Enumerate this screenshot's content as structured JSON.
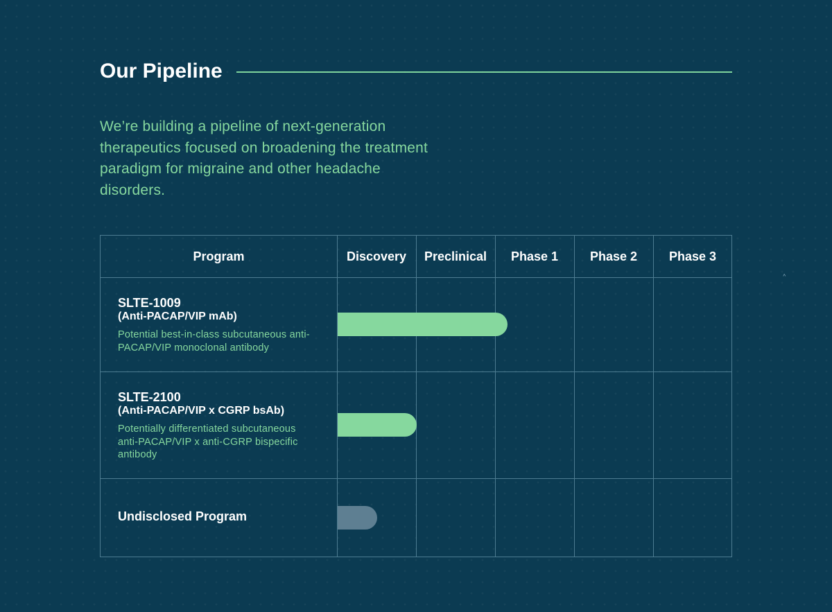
{
  "title": "Our Pipeline",
  "intro": "We’re building a pipeline of next-generation therapeutics focused on broadening the treatment paradigm for migraine and other headache disorders.",
  "table": {
    "headers": [
      "Program",
      "Discovery",
      "Preclinical",
      "Phase 1",
      "Phase 2",
      "Phase 3"
    ],
    "rows": [
      {
        "name": "SLTE-1009",
        "subtitle": "(Anti-PACAP/VIP mAb)",
        "description": "Potential best-in-class subcutaneous anti-PACAP/VIP monoclonal antibody",
        "progress_phases": 2.15,
        "bar_color": "#86d89e"
      },
      {
        "name": "SLTE-2100",
        "subtitle": "(Anti-PACAP/VIP x CGRP bsAb)",
        "description": "Potentially differentiated subcutaneous anti-PACAP/VIP x anti-CGRP bispecific antibody",
        "progress_phases": 1.0,
        "bar_color": "#86d89e"
      },
      {
        "name": "Undisclosed Program",
        "subtitle": "",
        "description": "",
        "progress_phases": 0.5,
        "bar_color": "#5e7f92"
      }
    ]
  },
  "scroll_icon": "chevron-up-icon",
  "colors": {
    "background": "#0b3b52",
    "accent": "#86d89e",
    "grid": "#4d7c91"
  }
}
